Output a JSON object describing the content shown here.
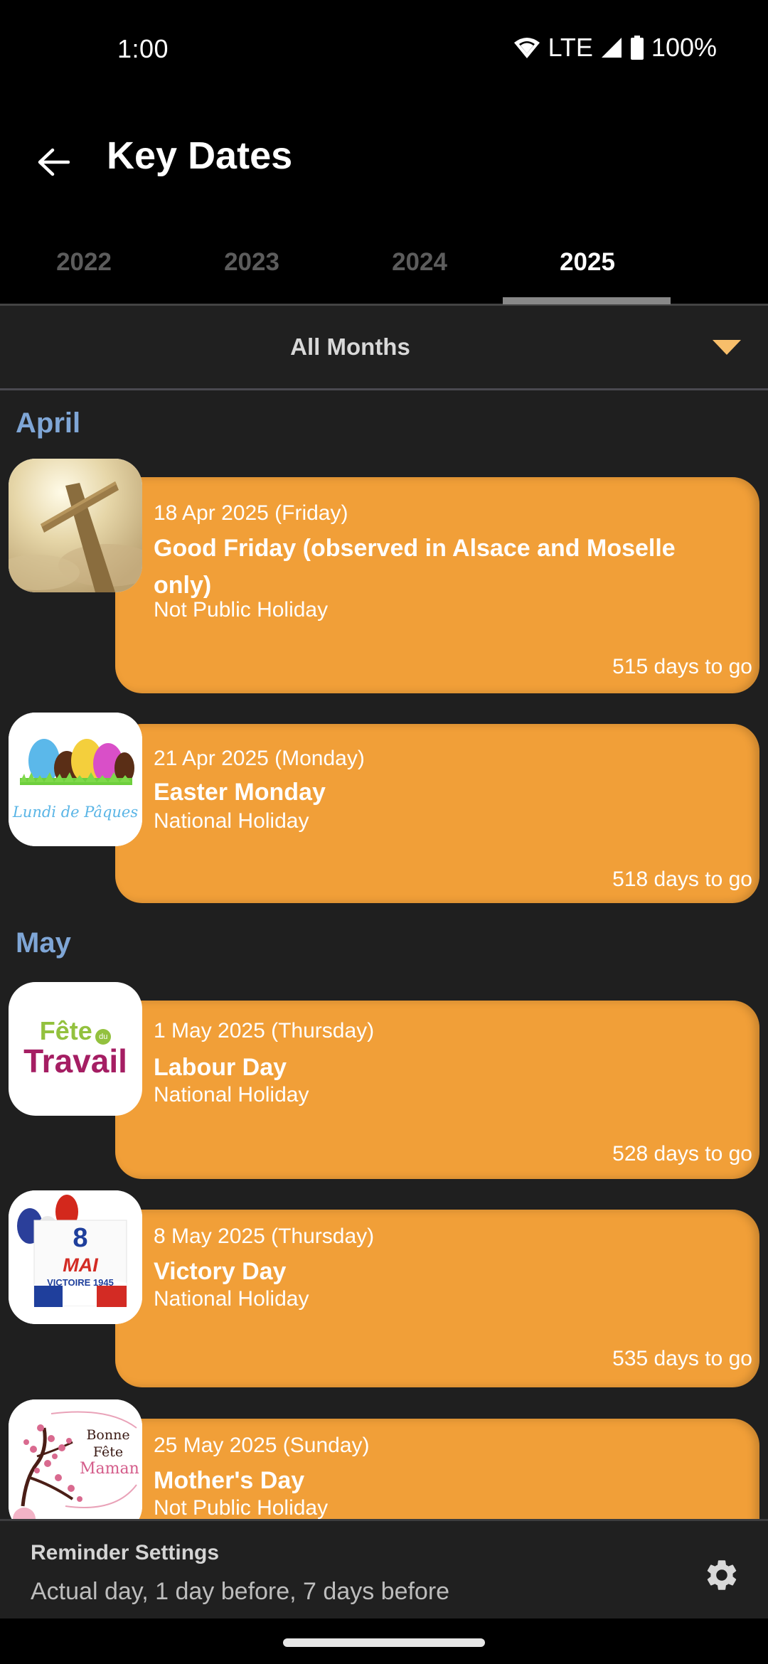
{
  "status_bar": {
    "time": "1:00",
    "network": "LTE",
    "battery": "100%",
    "icons": [
      "wifi-icon",
      "signal-icon",
      "battery-icon"
    ]
  },
  "app_bar": {
    "title": "Key Dates",
    "back_icon": "arrow-left-icon"
  },
  "tabs": [
    {
      "label": "2022",
      "active": false
    },
    {
      "label": "2023",
      "active": false
    },
    {
      "label": "2024",
      "active": false
    },
    {
      "label": "2025",
      "active": true
    }
  ],
  "month_filter": {
    "selected": "All Months",
    "icon": "triangle-down-icon",
    "accent": "#f7be6a"
  },
  "colors": {
    "card": "#f19f38",
    "month_header": "#7fa6d6",
    "background": "#1f1f1f"
  },
  "sections": [
    {
      "month": "April",
      "events": [
        {
          "date": "18 Apr 2025 (Friday)",
          "name": "Good Friday (observed in Alsace and Moselle only)",
          "type": "Not Public Holiday",
          "countdown": "515 days to go",
          "image": "cross-sky-image"
        },
        {
          "date": "21 Apr 2025 (Monday)",
          "name": "Easter Monday",
          "type": "National Holiday",
          "countdown": "518 days to go",
          "image": "easter-eggs-image",
          "image_caption": "Lundi de Pâques"
        }
      ]
    },
    {
      "month": "May",
      "events": [
        {
          "date": "1 May 2025 (Thursday)",
          "name": "Labour Day",
          "type": "National Holiday",
          "countdown": "528 days to go",
          "image": "fete-du-travail-image",
          "image_caption": [
            "Fête",
            "du",
            "Travail"
          ]
        },
        {
          "date": "8 May 2025 (Thursday)",
          "name": "Victory Day",
          "type": "National Holiday",
          "countdown": "535 days to go",
          "image": "victoire-1945-image",
          "image_caption": [
            "8",
            "MAI",
            "VICTOIRE 1945"
          ]
        },
        {
          "date": "25 May 2025 (Sunday)",
          "name": "Mother's Day",
          "type": "Not Public Holiday",
          "countdown": "",
          "image": "bonne-fete-maman-image",
          "image_caption": [
            "Bonne",
            "Fête",
            "Maman"
          ]
        }
      ]
    }
  ],
  "reminder": {
    "title": "Reminder Settings",
    "value": "Actual day, 1 day before, 7 days before",
    "icon": "gear-icon"
  }
}
